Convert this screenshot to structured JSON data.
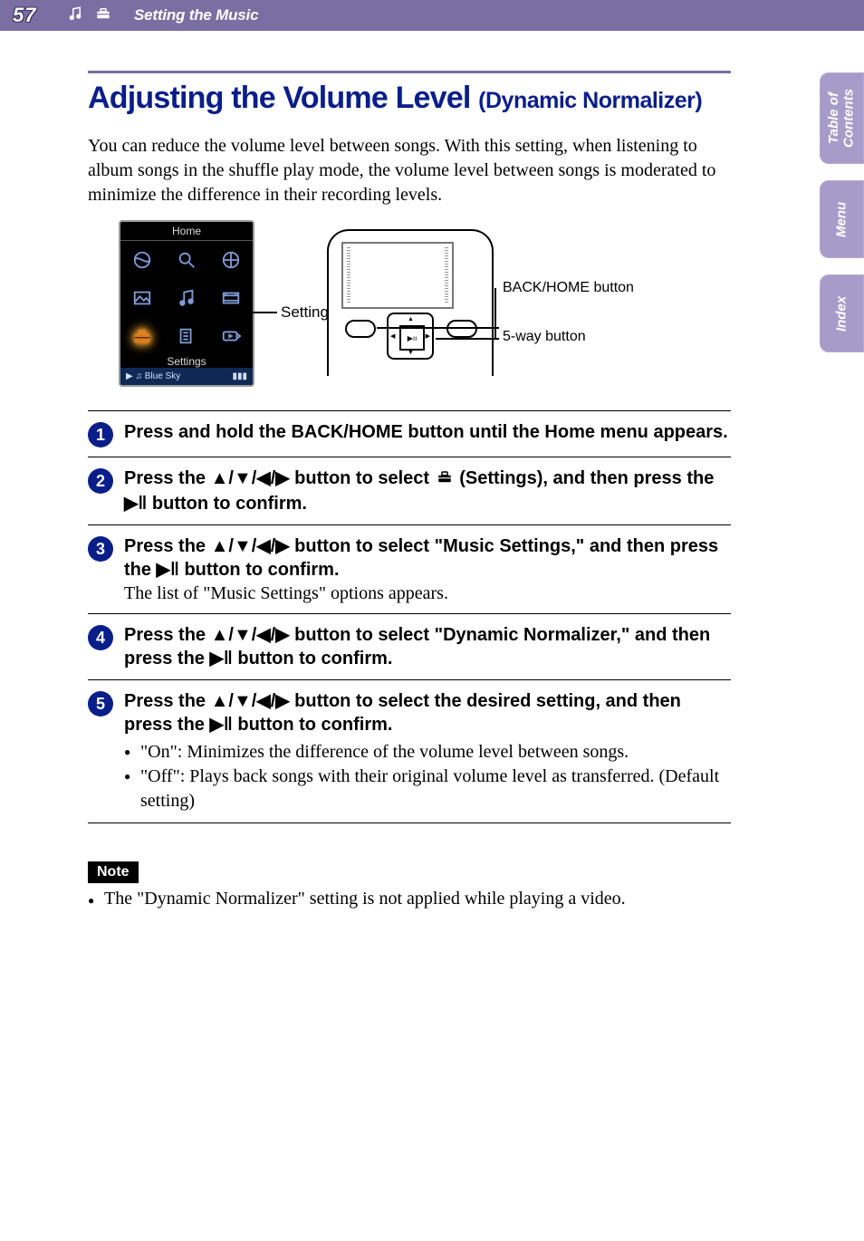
{
  "header": {
    "page_number": "57",
    "section_title": "Setting the Music"
  },
  "side_tabs": [
    "Table of\nContents",
    "Menu",
    "Index"
  ],
  "title_main": "Adjusting the Volume Level ",
  "title_sub": "(Dynamic Normalizer)",
  "intro": "You can reduce the volume level between songs. With this setting, when listening to album songs in the shuffle play mode, the volume level between songs is moderated to minimize the difference in their recording levels.",
  "home_screenshot": {
    "header": "Home",
    "selected_label": "Settings",
    "now_playing": "♫ Blue Sky"
  },
  "figure_labels": {
    "settings": "Settings",
    "back_home": "BACK/HOME button",
    "five_way": "5-way button"
  },
  "steps": [
    {
      "title_html": "Press and hold the BACK/HOME button until the Home menu appears."
    },
    {
      "title_html": "Press the ▲/▼/◀/▶ button to select {ICON} (Settings), and then press the ▶ǁ button to confirm."
    },
    {
      "title_html": "Press the ▲/▼/◀/▶ button to select \"Music Settings,\" and then press the ▶ǁ button to confirm.",
      "desc": "The list of \"Music Settings\" options appears."
    },
    {
      "title_html": "Press the ▲/▼/◀/▶ button to select \"Dynamic Normalizer,\" and then press the ▶ǁ button to confirm."
    },
    {
      "title_html": "Press the ▲/▼/◀/▶ button to select the desired setting, and then press the ▶ǁ button to confirm.",
      "bullets": [
        "\"On\": Minimizes the difference of the volume level between songs.",
        "\"Off\": Plays back songs with their original volume level as transferred. (Default setting)"
      ]
    }
  ],
  "note_label": "Note",
  "notes": [
    "The \"Dynamic Normalizer\" setting is not applied while playing a video."
  ]
}
